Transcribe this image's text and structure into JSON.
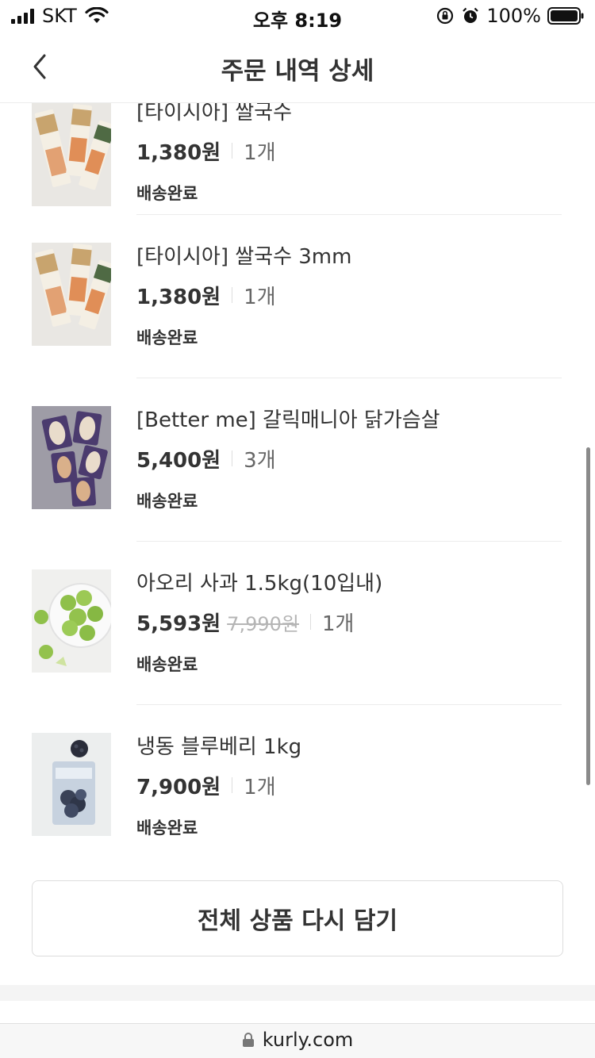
{
  "status_bar": {
    "carrier": "SKT",
    "time": "오후 8:19",
    "battery": "100%"
  },
  "header": {
    "title": "주문 내역 상세"
  },
  "products": [
    {
      "name": "[타이시아] 쌀국수",
      "price": "1,380원",
      "original_price": "",
      "quantity": "1개",
      "status": "배송완료",
      "thumbnail": "rice-noodle-package"
    },
    {
      "name": "[타이시아] 쌀국수 3mm",
      "price": "1,380원",
      "original_price": "",
      "quantity": "1개",
      "status": "배송완료",
      "thumbnail": "rice-noodle-package"
    },
    {
      "name": "[Better me] 갈릭매니아 닭가슴살",
      "price": "5,400원",
      "original_price": "",
      "quantity": "3개",
      "status": "배송완료",
      "thumbnail": "chicken-breast-package"
    },
    {
      "name": "아오리 사과 1.5kg(10입내)",
      "price": "5,593원",
      "original_price": "7,990원",
      "quantity": "1개",
      "status": "배송완료",
      "thumbnail": "green-apples"
    },
    {
      "name": "냉동 블루베리 1kg",
      "price": "7,900원",
      "original_price": "",
      "quantity": "1개",
      "status": "배송완료",
      "thumbnail": "frozen-blueberry-bag"
    }
  ],
  "reorder_button": "전체 상품 다시 담기",
  "browser": {
    "url": "kurly.com"
  },
  "colors": {
    "text": "#333333",
    "muted": "#666666",
    "strike": "#b5b5b5",
    "border": "#dddddd"
  }
}
